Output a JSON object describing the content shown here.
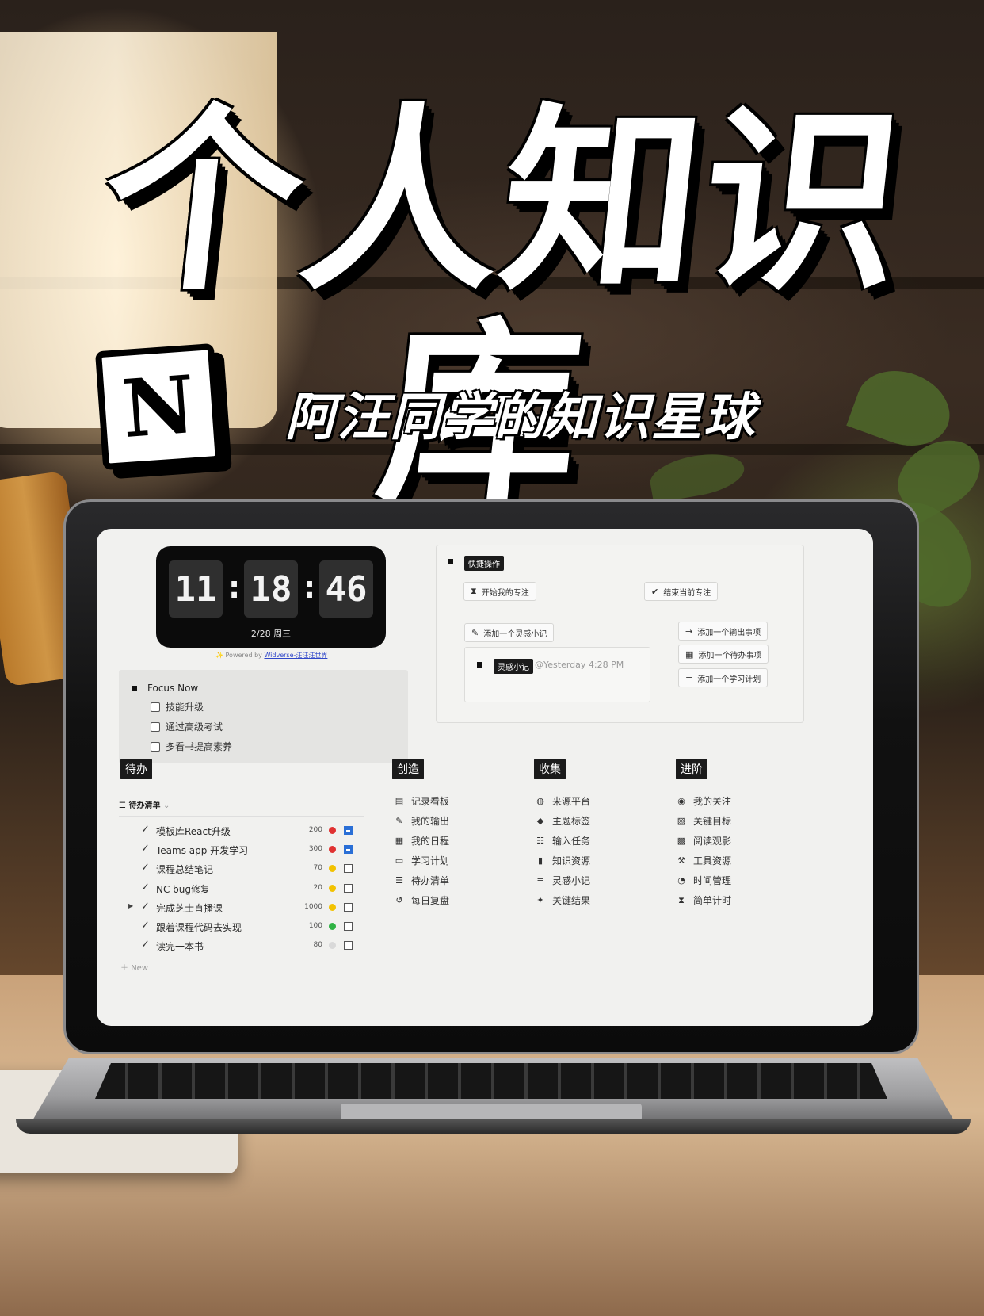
{
  "hero": {
    "title": "个人知识库",
    "logo_letter": "N",
    "subtitle": "阿汪同学的知识星球"
  },
  "clock": {
    "hours": "11",
    "minutes": "18",
    "seconds": "46",
    "date": "2/28 周三",
    "powered_prefix": "Powered by",
    "powered_link": "Widverse-汪汪汪世界"
  },
  "focus": {
    "title": "Focus Now",
    "items": [
      "技能升级",
      "通过高级考试",
      "多看书提高素养"
    ]
  },
  "quick": {
    "tag": "快捷操作",
    "start_focus": "开始我的专注",
    "end_focus": "结束当前专注",
    "add_note": "添加一个灵感小记",
    "add_output": "添加一个输出事项",
    "add_todo": "添加一个待办事项",
    "add_plan": "添加一个学习计划",
    "note_tag": "灵感小记",
    "note_time": "@Yesterday 4:28 PM"
  },
  "sections": {
    "todo": "待办",
    "create": "创造",
    "collect": "收集",
    "advance": "进阶"
  },
  "todo_list": {
    "view_label": "待办清单",
    "new_label": "New",
    "rows": [
      {
        "name": "模板库React升级",
        "num": "200",
        "dot": "#e03131",
        "checked": true,
        "toggle": false
      },
      {
        "name": "Teams app 开发学习",
        "num": "300",
        "dot": "#e03131",
        "checked": true,
        "toggle": false
      },
      {
        "name": "课程总结笔记",
        "num": "70",
        "dot": "#f2c200",
        "checked": false,
        "toggle": false
      },
      {
        "name": "NC bug修复",
        "num": "20",
        "dot": "#f2c200",
        "checked": false,
        "toggle": false
      },
      {
        "name": "完成芝士直播课",
        "num": "1000",
        "dot": "#f2c200",
        "checked": false,
        "toggle": true
      },
      {
        "name": "跟着课程代码去实现",
        "num": "100",
        "dot": "#2fb344",
        "checked": false,
        "toggle": false
      },
      {
        "name": "读完一本书",
        "num": "80",
        "dot": "#d9d9d9",
        "checked": false,
        "toggle": false
      }
    ]
  },
  "create_links": [
    {
      "icon": "board-icon",
      "glyph": "▤",
      "label": "记录看板"
    },
    {
      "icon": "pencil-icon",
      "glyph": "✎",
      "label": "我的输出"
    },
    {
      "icon": "calendar-icon",
      "glyph": "▦",
      "label": "我的日程"
    },
    {
      "icon": "card-icon",
      "glyph": "▭",
      "label": "学习计划"
    },
    {
      "icon": "checklist-icon",
      "glyph": "☰",
      "label": "待办清单"
    },
    {
      "icon": "history-icon",
      "glyph": "↺",
      "label": "每日复盘"
    }
  ],
  "collect_links": [
    {
      "icon": "globe-icon",
      "glyph": "◍",
      "label": "来源平台"
    },
    {
      "icon": "tag-icon",
      "glyph": "◆",
      "label": "主题标签"
    },
    {
      "icon": "list-icon",
      "glyph": "☷",
      "label": "输入任务"
    },
    {
      "icon": "bookmark-icon",
      "glyph": "▮",
      "label": "知识资源"
    },
    {
      "icon": "note-icon",
      "glyph": "≡",
      "label": "灵感小记"
    },
    {
      "icon": "sparkle-icon",
      "glyph": "✦",
      "label": "关键结果"
    }
  ],
  "advance_links": [
    {
      "icon": "user-icon",
      "glyph": "◉",
      "label": "我的关注"
    },
    {
      "icon": "chart-icon",
      "glyph": "▨",
      "label": "关键目标"
    },
    {
      "icon": "film-icon",
      "glyph": "▩",
      "label": "阅读观影"
    },
    {
      "icon": "hammer-icon",
      "glyph": "⚒",
      "label": "工具资源"
    },
    {
      "icon": "clock-icon",
      "glyph": "◔",
      "label": "时间管理"
    },
    {
      "icon": "hourglass-icon",
      "glyph": "⧗",
      "label": "简单计时"
    }
  ]
}
